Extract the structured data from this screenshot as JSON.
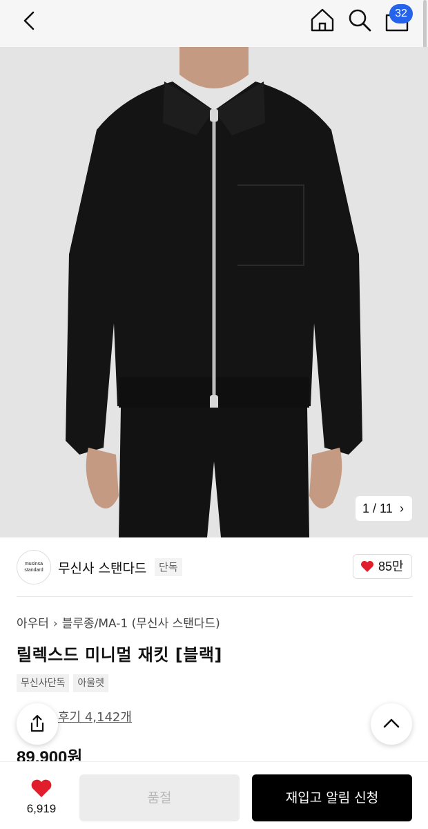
{
  "header": {
    "cart_count": "32",
    "icons": [
      "back-icon",
      "home-icon",
      "search-icon",
      "cart-icon"
    ]
  },
  "gallery": {
    "counter": "1 / 11",
    "counter_icon": "chevron-right-icon"
  },
  "brand": {
    "logo_line1": "musinsa",
    "logo_line2": "standard",
    "name": "무신사 스탠다드",
    "tag": "단독",
    "likes": "85만",
    "like_color": "#e01e2c"
  },
  "product": {
    "breadcrumb": [
      "아우터",
      "블루종/MA-1 (무신사 스탠다드)"
    ],
    "title": "릴렉스드 미니멀 재킷 [블랙]",
    "chips": [
      "무신사단독",
      "아울렛"
    ],
    "review": "후기 4,142개",
    "price": "89.900원"
  },
  "bottom": {
    "fav_count": "6,919",
    "soldout_label": "품절",
    "restock_label": "재입고 알림 신청"
  },
  "colors": {
    "accent": "#2563eb",
    "heart": "#e01e2c",
    "primary_button": "#000000"
  }
}
